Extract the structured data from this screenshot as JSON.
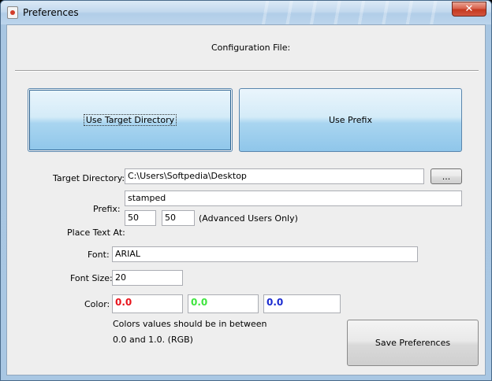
{
  "window": {
    "title": "Preferences",
    "close_glyph": "✕"
  },
  "config": {
    "label": "Configuration File:"
  },
  "mode_buttons": {
    "target_dir": "Use Target Directory",
    "prefix": "Use Prefix"
  },
  "target_directory": {
    "label": "Target Directory:",
    "value": "C:\\Users\\Softpedia\\Desktop",
    "browse_label": "..."
  },
  "prefix": {
    "label": "Prefix:",
    "value": "stamped"
  },
  "position": {
    "label": "Place Text At:",
    "x": "50",
    "y": "50",
    "note": "(Advanced Users Only)"
  },
  "font": {
    "label": "Font:",
    "value": "ARIAL"
  },
  "font_size": {
    "label": "Font Size:",
    "value": "20"
  },
  "color": {
    "label": "Color:",
    "r": "0.0",
    "g": "0.0",
    "b": "0.0",
    "r_color": "#e8141c",
    "g_color": "#3fe53f",
    "b_color": "#1a2bd0",
    "hint_line1": "Colors values should be in between",
    "hint_line2": "0.0 and 1.0. (RGB)"
  },
  "save_button": "Save Preferences",
  "theme": {
    "accent": "#8fc6ea",
    "titlebar": "#bcd5ec",
    "close": "#c5391f"
  }
}
